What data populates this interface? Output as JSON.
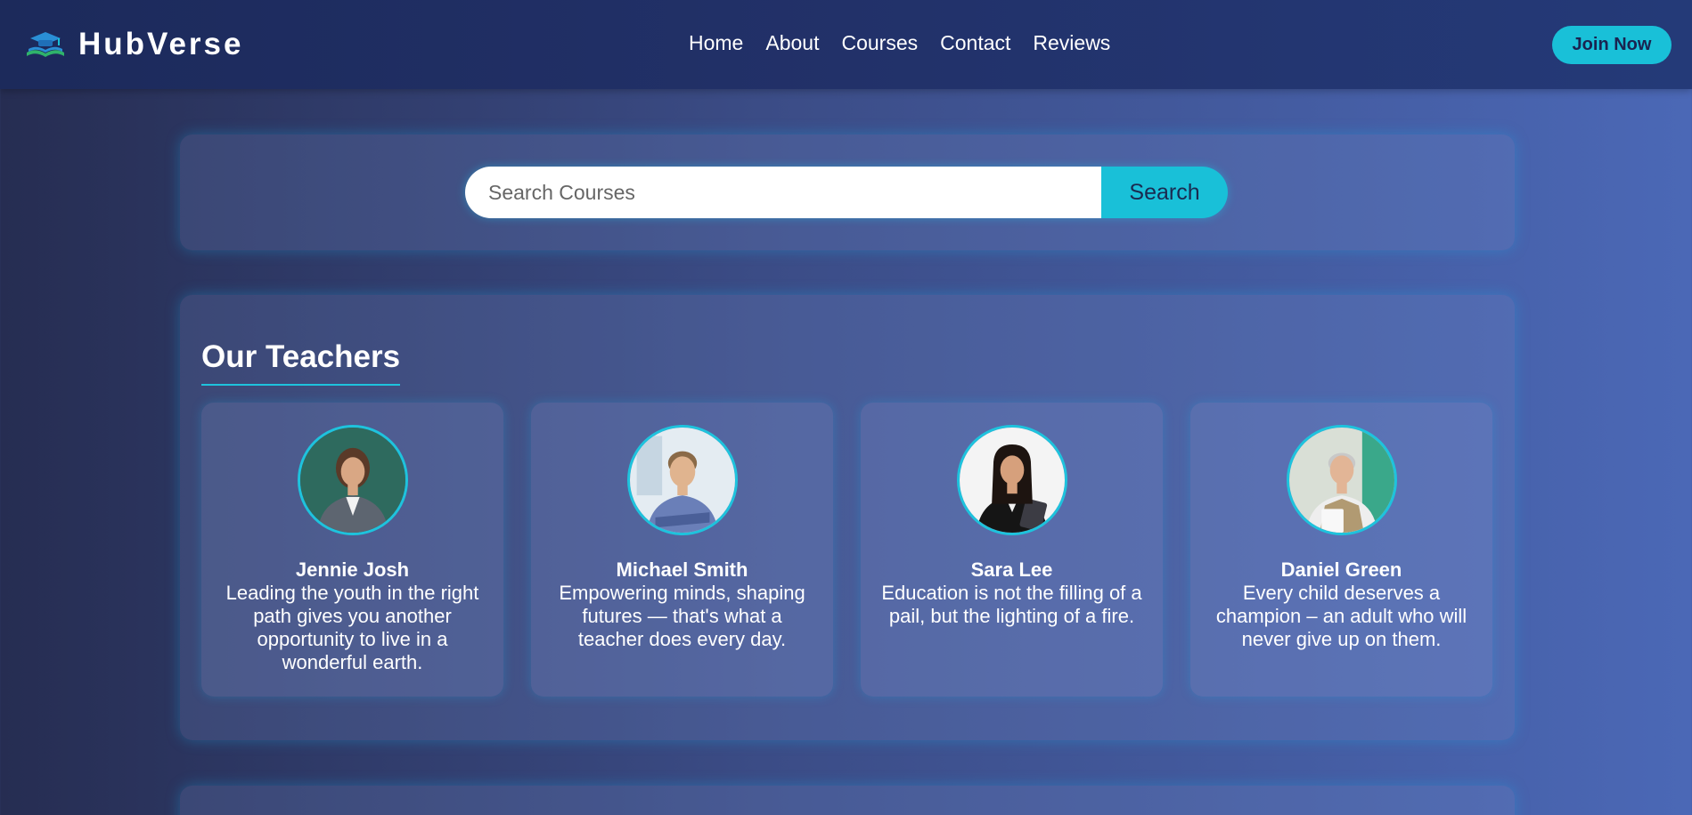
{
  "brand": {
    "name": "HubVerse",
    "accent": "#19c0d8"
  },
  "nav": {
    "items": [
      "Home",
      "About",
      "Courses",
      "Contact",
      "Reviews"
    ],
    "join_label": "Join Now"
  },
  "search": {
    "placeholder": "Search Courses",
    "button_label": "Search"
  },
  "teachers": {
    "title": "Our Teachers",
    "items": [
      {
        "name": "Jennie Josh",
        "quote": "Leading the youth in the right path gives you another opportunity to live in a wonderful earth."
      },
      {
        "name": "Michael Smith",
        "quote": "Empowering minds, shaping futures — that's what a teacher does every day."
      },
      {
        "name": "Sara Lee",
        "quote": "Education is not the filling of a pail, but the lighting of a fire."
      },
      {
        "name": "Daniel Green",
        "quote": "Every child deserves a champion – an adult who will never give up on them."
      }
    ]
  }
}
